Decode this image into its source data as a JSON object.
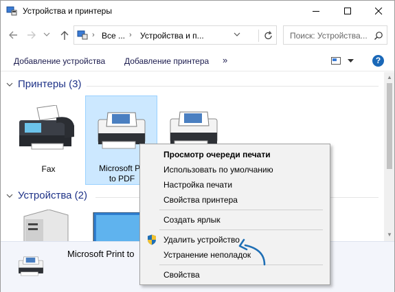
{
  "window": {
    "title": "Устройства и принтеры",
    "controls": [
      "minimize",
      "maximize",
      "close"
    ]
  },
  "address_bar": {
    "crumbs": [
      "Все ...",
      "Устройства и п..."
    ],
    "search_placeholder": "Поиск: Устройства..."
  },
  "commands": {
    "add_device": "Добавление устройства",
    "add_printer": "Добавление принтера",
    "more": "»"
  },
  "groups": {
    "printers": {
      "title": "Принтеры (3)"
    },
    "devices": {
      "title": "Устройства (2)"
    }
  },
  "printers": [
    {
      "label": "Fax",
      "selected": false
    },
    {
      "label": "Microsoft Print to PDF",
      "label_line1": "Microsoft Pri",
      "label_line2": "to PDF",
      "selected": true
    },
    {
      "label": "",
      "selected": false
    }
  ],
  "details": {
    "name": "Microsoft Print to"
  },
  "context_menu": {
    "items": [
      {
        "label": "Просмотр очереди печати",
        "bold": true
      },
      {
        "label": "Использовать по умолчанию"
      },
      {
        "label": "Настройка печати"
      },
      {
        "label": "Свойства принтера"
      },
      {
        "label": "Создать ярлык"
      },
      {
        "label": "Удалить устройство",
        "icon": "uac-shield-icon"
      },
      {
        "label": "Устранение неполадок"
      },
      {
        "label": "Свойства"
      }
    ]
  },
  "colors": {
    "selection_bg": "#cce8ff",
    "group_header": "#1e3287",
    "annotation_arrow": "#1f6fb5"
  }
}
